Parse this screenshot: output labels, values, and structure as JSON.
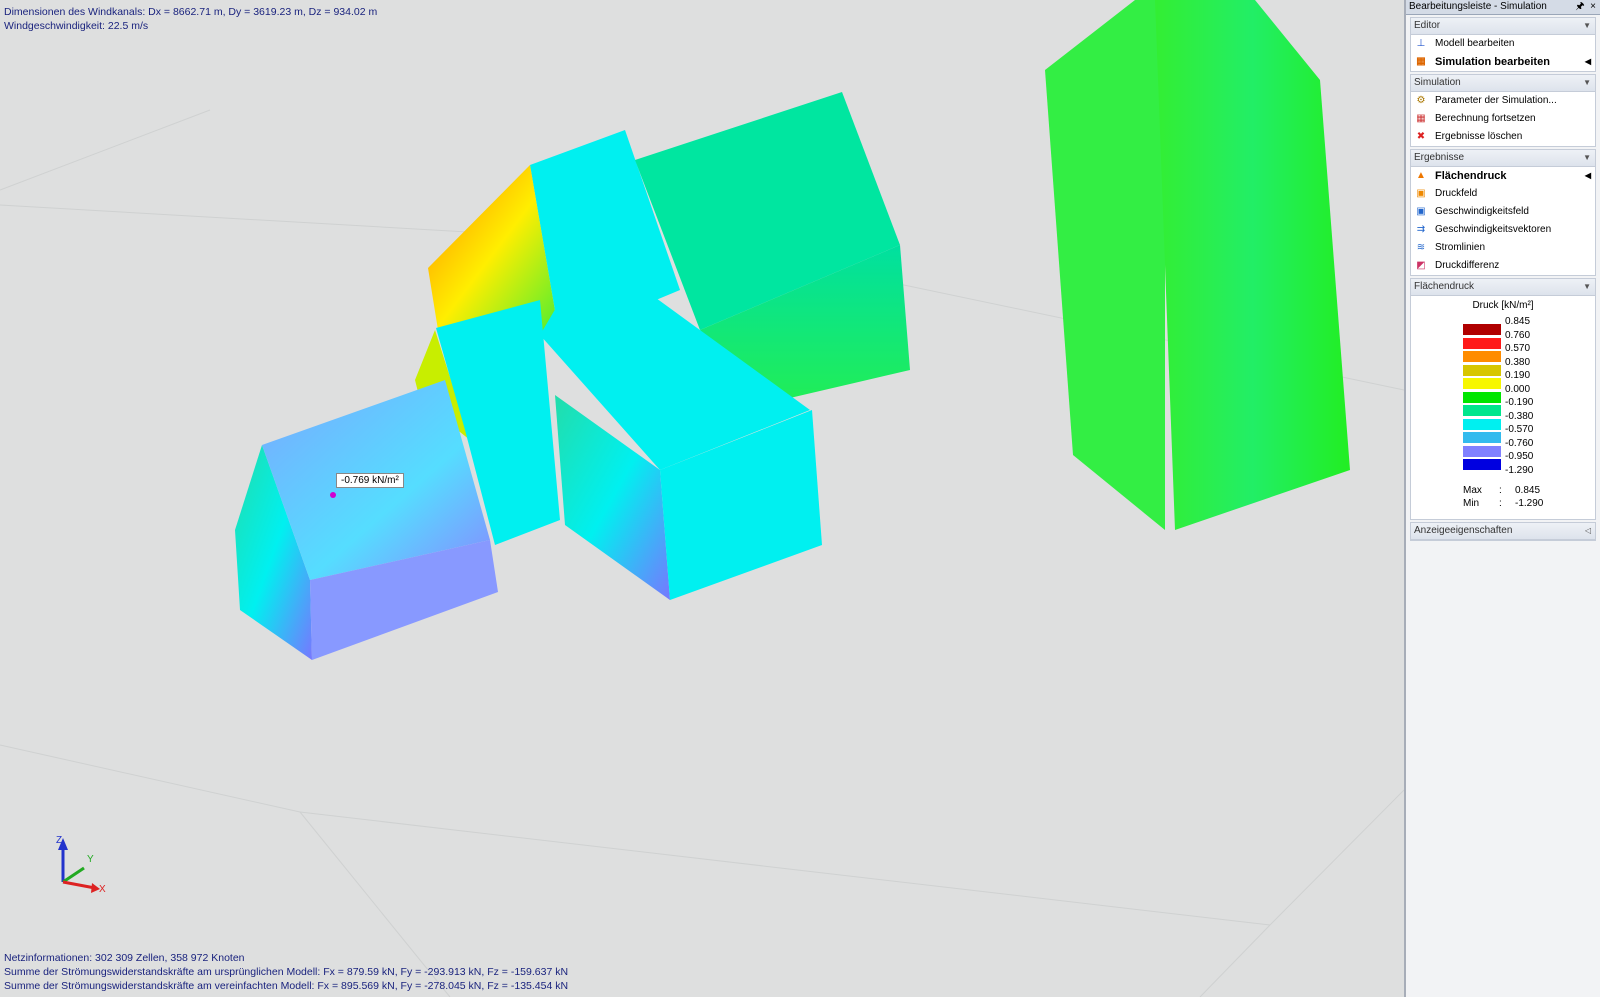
{
  "overlay": {
    "top_line1": "Dimensionen des Windkanals: Dx = 8662.71 m, Dy = 3619.23 m, Dz = 934.02 m",
    "top_line2": "Windgeschwindigkeit: 22.5 m/s",
    "bottom_line1": "Netzinformationen: 302 309 Zellen, 358 972 Knoten",
    "bottom_line2": "Summe der Strömungswiderstandskräfte am ursprünglichen Modell: Fx = 879.59 kN, Fy = -293.913 kN, Fz = -159.637 kN",
    "bottom_line3": "Summe der Strömungswiderstandskräfte am vereinfachten Modell: Fx = 895.569 kN, Fy = -278.045 kN, Fz = -135.454 kN",
    "tooltip": "-0.769 kN/m²"
  },
  "axes": {
    "z": "Z",
    "y": "Y",
    "x": "X"
  },
  "panel": {
    "title": "Bearbeitungsleiste - Simulation",
    "pin": "🖈",
    "close": "×",
    "sections": {
      "editor": {
        "header": "Editor",
        "items": [
          "Modell bearbeiten",
          "Simulation bearbeiten"
        ]
      },
      "simulation": {
        "header": "Simulation",
        "items": [
          "Parameter der Simulation...",
          "Berechnung fortsetzen",
          "Ergebnisse löschen"
        ]
      },
      "ergebnisse": {
        "header": "Ergebnisse",
        "items": [
          "Flächendruck",
          "Druckfeld",
          "Geschwindigkeitsfeld",
          "Geschwindigkeitsvektoren",
          "Stromlinien",
          "Druckdifferenz"
        ]
      },
      "flaechendruck": {
        "header": "Flächendruck"
      },
      "anzeige": {
        "header": "Anzeigeeigenschaften"
      }
    },
    "legend": {
      "title": "Druck [kN/m²]",
      "values": [
        "0.845",
        "0.760",
        "0.570",
        "0.380",
        "0.190",
        "0.000",
        "-0.190",
        "-0.380",
        "-0.570",
        "-0.760",
        "-0.950",
        "-1.290"
      ],
      "colors": [
        "#b00000",
        "#ff1a1a",
        "#ff8c00",
        "#d7c600",
        "#f7f700",
        "#00e600",
        "#00e68c",
        "#00f0f0",
        "#33bbee",
        "#8080ff",
        "#0000e0"
      ],
      "max_label": "Max",
      "min_label": "Min",
      "colon": ":",
      "max": "0.845",
      "min": "-1.290"
    }
  }
}
